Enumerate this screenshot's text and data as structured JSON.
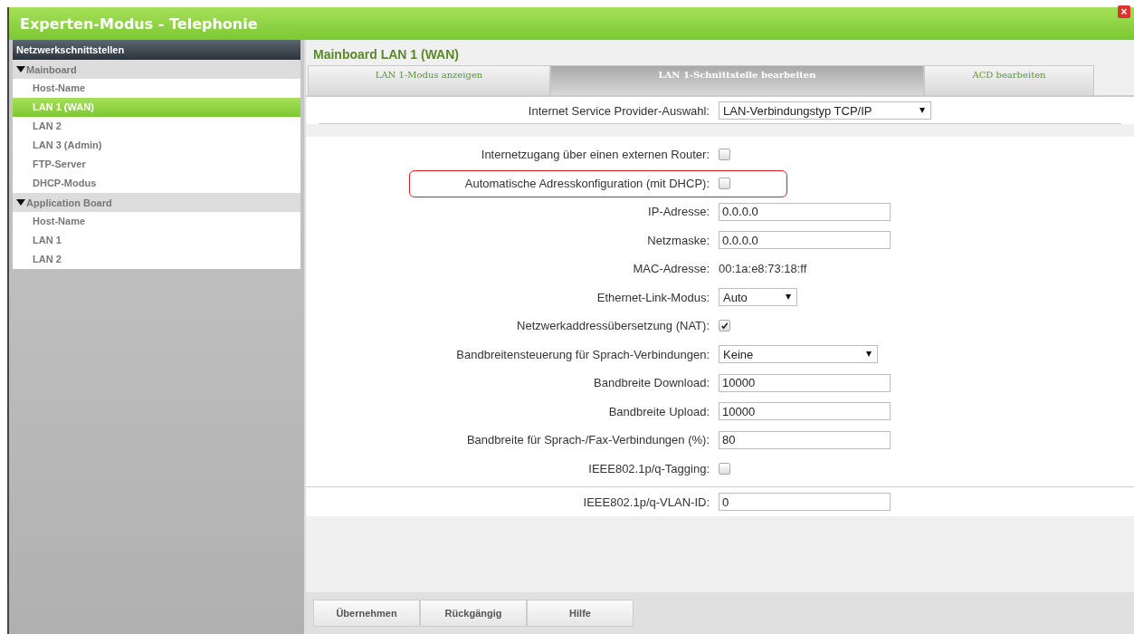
{
  "window": {
    "title": "Experten-Modus - Telephonie",
    "close": "×"
  },
  "sidebar": {
    "header": "Netzwerkschnittstellen",
    "groups": [
      {
        "label": "Mainboard",
        "expanded": true,
        "children": [
          {
            "label": "Host-Name",
            "selected": false
          },
          {
            "label": "LAN 1 (WAN)",
            "selected": true
          },
          {
            "label": "LAN 2",
            "selected": false
          },
          {
            "label": "LAN 3 (Admin)",
            "selected": false
          },
          {
            "label": "FTP-Server",
            "selected": false
          },
          {
            "label": "DHCP-Modus",
            "selected": false
          }
        ]
      },
      {
        "label": "Application Board",
        "expanded": true,
        "children": [
          {
            "label": "Host-Name",
            "selected": false
          },
          {
            "label": "LAN 1",
            "selected": false
          },
          {
            "label": "LAN 2",
            "selected": false
          }
        ]
      }
    ]
  },
  "main": {
    "title": "Mainboard LAN 1 (WAN)",
    "tabs": [
      {
        "label": "LAN 1-Modus anzeigen",
        "selected": false
      },
      {
        "label": "LAN 1-Schnittstelle bearbeiten",
        "selected": true
      },
      {
        "label": "ACD bearbeiten",
        "selected": false
      }
    ],
    "sections": [
      {
        "fields": [
          {
            "kind": "select",
            "label": "Internet Service Provider-Auswahl:",
            "value": "LAN-Verbindungstyp TCP/IP",
            "highlighted": false
          }
        ]
      },
      {
        "fields": [
          {
            "kind": "checkbox",
            "label": "Internetzugang über einen externen Router:",
            "checked": false,
            "highlighted": false
          },
          {
            "kind": "checkbox",
            "label": "Automatische Adresskonfiguration (mit DHCP):",
            "checked": false,
            "highlighted": true
          },
          {
            "kind": "text",
            "label": "IP-Adresse:",
            "value": "0.0.0.0",
            "highlighted": false
          },
          {
            "kind": "text",
            "label": "Netzmaske:",
            "value": "0.0.0.0",
            "highlighted": false
          },
          {
            "kind": "static",
            "label": "MAC-Adresse:",
            "value": "00:1a:e8:73:18:ff",
            "highlighted": false
          },
          {
            "kind": "select",
            "label": "Ethernet-Link-Modus:",
            "value": "Auto",
            "highlighted": false
          },
          {
            "kind": "checkbox",
            "label": "Netzwerkaddressübersetzung (NAT):",
            "checked": true,
            "highlighted": false
          },
          {
            "kind": "select",
            "label": "Bandbreitensteuerung für Sprach-Verbindungen:",
            "value": "Keine",
            "highlighted": false
          },
          {
            "kind": "text",
            "label": "Bandbreite Download:",
            "value": "10000",
            "highlighted": false
          },
          {
            "kind": "text",
            "label": "Bandbreite Upload:",
            "value": "10000",
            "highlighted": false
          },
          {
            "kind": "text",
            "label": "Bandbreite für Sprach-/Fax-Verbindungen (%):",
            "value": "80",
            "highlighted": false
          },
          {
            "kind": "checkbox",
            "label": "IEEE802.1p/q-Tagging:",
            "checked": false,
            "highlighted": false
          }
        ]
      },
      {
        "fields": [
          {
            "kind": "text",
            "label": "IEEE802.1p/q-VLAN-ID:",
            "value": "0",
            "highlighted": false
          }
        ]
      }
    ],
    "buttons": [
      "Übernehmen",
      "Rückgängig",
      "Hilfe"
    ]
  }
}
